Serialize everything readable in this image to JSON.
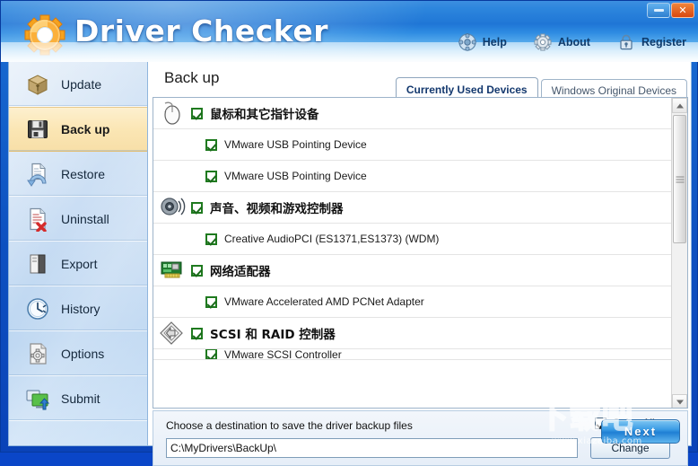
{
  "window": {
    "title": "Driver Checker",
    "buttons": [
      {
        "name": "minimize",
        "glyph": ""
      },
      {
        "name": "close",
        "glyph": "✕"
      }
    ]
  },
  "header": {
    "actions": [
      {
        "icon": "help-icon",
        "label": "Help"
      },
      {
        "icon": "gear-icon",
        "label": "About"
      },
      {
        "icon": "lock-icon",
        "label": "Register"
      }
    ]
  },
  "sidebar": {
    "items": [
      {
        "icon": "box-icon",
        "label": "Update",
        "active": false
      },
      {
        "icon": "floppy-icon",
        "label": "Back up",
        "active": true
      },
      {
        "icon": "restore-icon",
        "label": "Restore",
        "active": false
      },
      {
        "icon": "uninstall-icon",
        "label": "Uninstall",
        "active": false
      },
      {
        "icon": "export-icon",
        "label": "Export",
        "active": false
      },
      {
        "icon": "clock-icon",
        "label": "History",
        "active": false
      },
      {
        "icon": "options-icon",
        "label": "Options",
        "active": false
      },
      {
        "icon": "submit-icon",
        "label": "Submit",
        "active": false
      }
    ]
  },
  "main": {
    "page_title": "Back up",
    "tabs": [
      {
        "label": "Currently Used Devices",
        "active": true
      },
      {
        "label": "Windows Original Devices",
        "active": false
      }
    ],
    "device_groups": [
      {
        "icon": "mouse-icon",
        "label": "鼠标和其它指针设备",
        "checked": true,
        "devices": [
          {
            "label": "VMware USB Pointing Device",
            "checked": true
          },
          {
            "label": "VMware USB Pointing Device",
            "checked": true
          }
        ]
      },
      {
        "icon": "speaker-icon",
        "label": "声音、视频和游戏控制器",
        "checked": true,
        "devices": [
          {
            "label": "Creative AudioPCI (ES1371,ES1373) (WDM)",
            "checked": true
          }
        ]
      },
      {
        "icon": "network-card-icon",
        "label": "网络适配器",
        "checked": true,
        "devices": [
          {
            "label": "VMware Accelerated AMD PCNet Adapter",
            "checked": true
          }
        ]
      },
      {
        "icon": "scsi-icon",
        "label": "SCSI 和 RAID 控制器",
        "checked": true,
        "devices": [
          {
            "label": "VMware SCSI Controller",
            "checked": true,
            "clipped": true
          }
        ]
      }
    ],
    "scrollbar": {
      "thumb_top_pct": 5,
      "thumb_height_pct": 41
    }
  },
  "bottom": {
    "destination_label": "Choose a destination to save the driver backup files",
    "path_value": "C:\\MyDrivers\\BackUp\\",
    "path_placeholder": "C:\\",
    "change_label": "Change",
    "select_all_label": "SelectAll",
    "select_all_checked": true
  },
  "footer": {
    "next_label": "Next"
  },
  "watermark": {
    "text_cn": "下载吧",
    "url": "www.xiazaiba.com"
  },
  "colors": {
    "title_gradient_top": "#3c8fe0",
    "title_gradient_bottom": "#a9d9f8",
    "window_border": "#0a43b8",
    "accent_blue": "#1f7fd4",
    "active_nav_bg": "#fbe6b4",
    "check_green": "#1f7a1f",
    "close_orange": "#d9480f"
  }
}
